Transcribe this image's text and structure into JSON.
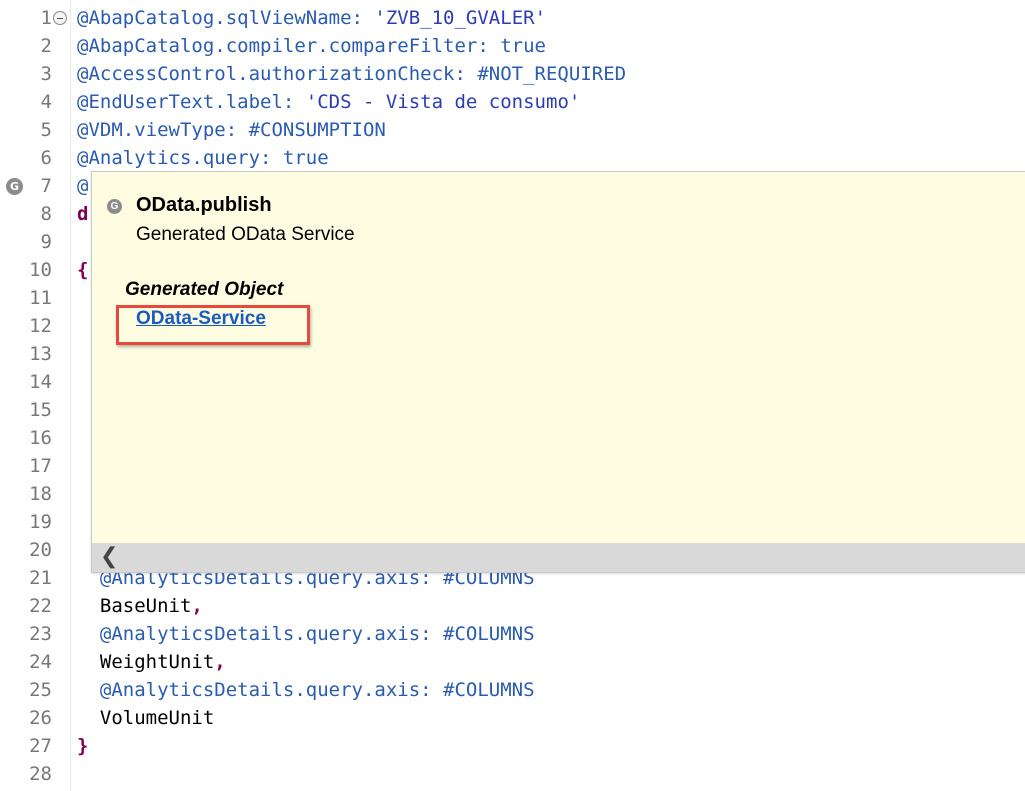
{
  "editor": {
    "lines": [
      {
        "n": "1",
        "segments": [
          {
            "t": "@AbapCatalog.sqlViewName: ",
            "c": "annot"
          },
          {
            "t": "'ZVB_10_GVALER'",
            "c": "str"
          }
        ]
      },
      {
        "n": "2",
        "segments": [
          {
            "t": "@AbapCatalog.compiler.compareFilter: true",
            "c": "annot"
          }
        ]
      },
      {
        "n": "3",
        "segments": [
          {
            "t": "@AccessControl.authorizationCheck: #NOT_REQUIRED",
            "c": "annot"
          }
        ]
      },
      {
        "n": "4",
        "segments": [
          {
            "t": "@EndUserText.label: ",
            "c": "annot"
          },
          {
            "t": "'CDS - Vista de consumo'",
            "c": "str"
          }
        ]
      },
      {
        "n": "5",
        "segments": [
          {
            "t": "@VDM.viewType: #CONSUMPTION",
            "c": "annot"
          }
        ]
      },
      {
        "n": "6",
        "segments": [
          {
            "t": "@Analytics.query: true",
            "c": "annot"
          }
        ]
      },
      {
        "n": "7",
        "segments": [
          {
            "t": "@",
            "c": "annot"
          }
        ]
      },
      {
        "n": "8",
        "segments": [
          {
            "t": "d",
            "c": "kw"
          }
        ]
      },
      {
        "n": "9",
        "segments": []
      },
      {
        "n": "10",
        "segments": [
          {
            "t": "{",
            "c": "kw"
          }
        ]
      },
      {
        "n": "11",
        "segments": []
      },
      {
        "n": "12",
        "segments": []
      },
      {
        "n": "13",
        "segments": []
      },
      {
        "n": "14",
        "segments": []
      },
      {
        "n": "15",
        "segments": []
      },
      {
        "n": "16",
        "segments": []
      },
      {
        "n": "17",
        "segments": []
      },
      {
        "n": "18",
        "segments": []
      },
      {
        "n": "19",
        "segments": []
      },
      {
        "n": "20",
        "segments": []
      },
      {
        "n": "21",
        "segments": [
          {
            "t": "  @AnalyticsDetails.query.axis: #COLUMNS",
            "c": "annot"
          }
        ]
      },
      {
        "n": "22",
        "segments": [
          {
            "t": "  BaseUnit",
            "c": "plain"
          },
          {
            "t": ",",
            "c": "kw"
          }
        ]
      },
      {
        "n": "23",
        "segments": [
          {
            "t": "  @AnalyticsDetails.query.axis: #COLUMNS",
            "c": "annot"
          }
        ]
      },
      {
        "n": "24",
        "segments": [
          {
            "t": "  WeightUnit",
            "c": "plain"
          },
          {
            "t": ",",
            "c": "kw"
          }
        ]
      },
      {
        "n": "25",
        "segments": [
          {
            "t": "  @AnalyticsDetails.query.axis: #COLUMNS",
            "c": "annot"
          }
        ]
      },
      {
        "n": "26",
        "segments": [
          {
            "t": "  VolumeUnit",
            "c": "plain"
          }
        ]
      },
      {
        "n": "27",
        "segments": [
          {
            "t": "}",
            "c": "kw"
          }
        ]
      },
      {
        "n": "28",
        "segments": []
      }
    ],
    "marker_glyph": "G",
    "colors": {
      "annotation": "#2a5bb0",
      "keyword": "#7f0055",
      "string": "#2b3cb5",
      "popup_bg": "#fefde2",
      "highlight_box": "#e64a3c",
      "link": "#1a5bbf"
    }
  },
  "popup": {
    "marker_glyph": "G",
    "title": "OData.publish",
    "subtitle": "Generated OData Service",
    "section_label": "Generated Object",
    "link_label": "OData-Service",
    "scroll_left_glyph": "❮"
  }
}
